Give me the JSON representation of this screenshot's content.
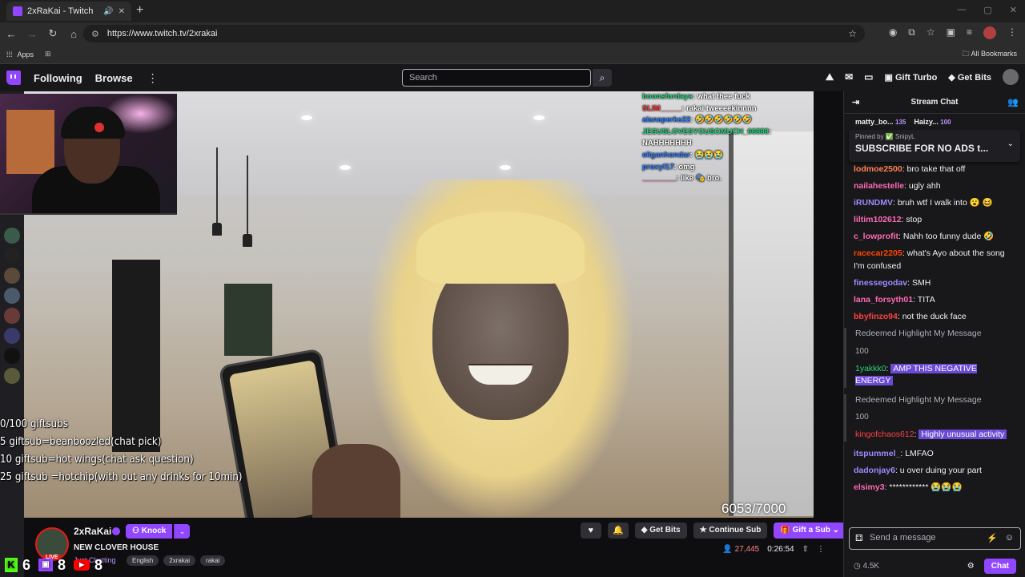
{
  "browser": {
    "tab_title": "2xRaKai - Twitch",
    "url": "https://www.twitch.tv/2xrakai",
    "bookmarks_apps": "Apps",
    "all_bookmarks": "All Bookmarks"
  },
  "nav": {
    "following": "Following",
    "browse": "Browse",
    "search_placeholder": "Search",
    "gift_turbo": "Gift Turbo",
    "get_bits": "Get Bits"
  },
  "overlay_chat": [
    {
      "user": "boonsfordays",
      "msg": "what thee fuck",
      "color": "#27d37a"
    },
    {
      "user": "SLIM_____",
      "msg": "rakai tweeeekinnnn",
      "color": "#ff3b3b"
    },
    {
      "user": "alanaperks22",
      "msg": "🤣🤣🤣🤣🤣🤣",
      "color": "#2d7cff"
    },
    {
      "user": "JESUSLOVESYOUSOMUCH_66888",
      "msg": "NAHHHHHHH",
      "color": "#27d37a"
    },
    {
      "user": "eliganhondar",
      "msg": "😭😭😭",
      "color": "#2d7cff"
    },
    {
      "user": "proxyf17",
      "msg": "omg",
      "color": "#2d7cff"
    },
    {
      "user": "________",
      "msg": "like 🎭 bro.",
      "color": "#ff3b3b"
    }
  ],
  "gift_goals": {
    "line1": "0/100 giftsubs",
    "line2": "5 giftsub=beanboozled(chat pick)",
    "line3": "10 giftsub=hot wings(chat ask question)",
    "line4": "25 giftsub =hotchip(with out any drinks for 10min)"
  },
  "view_progress": "6053/7000",
  "channel": {
    "name": "2xRaKai",
    "knock_label": "Knock",
    "stream_title": "NEW CLOVER HOUSE",
    "category": "Just Chatting",
    "tags": [
      "English",
      "2xrakai",
      "rakai"
    ],
    "live_badge": "LIVE",
    "get_bits": "Get Bits",
    "continue_sub": "Continue Sub",
    "gift_sub": "Gift a Sub",
    "viewers": "27,445",
    "uptime": "0:26:54"
  },
  "bottom_overlay": {
    "kick_count": "6",
    "twitch_count": "8",
    "youtube_count": "8"
  },
  "chat": {
    "header": "Stream Chat",
    "leaderboard": [
      {
        "name": "matty_bo...",
        "pts": "135"
      },
      {
        "name": "Haizy...",
        "pts": "100"
      }
    ],
    "pinned_by": "Pinned by ✅ SnipyL",
    "pinned_text": "SUBSCRIBE FOR NO ADS t...",
    "messages": [
      {
        "user": "lodmoe2500",
        "text": "bro take that off",
        "color": "#ff7f50"
      },
      {
        "user": "nailahestelle",
        "text": "ugly ahh",
        "color": "#ff69b4"
      },
      {
        "user": "iRUNDMV",
        "text": "bruh wtf I walk into 😮 😆",
        "color": "#9b8cff"
      },
      {
        "user": "liltim102612",
        "text": "stop",
        "color": "#ff69b4"
      },
      {
        "user": "c_lowprofit",
        "text": "Nahh too funny dude 🤣",
        "color": "#ff69b4"
      },
      {
        "user": "racecar2205",
        "text": "what's Ayo about the song I'm confused",
        "color": "#ff4500"
      },
      {
        "user": "finessegodav",
        "text": "SMH",
        "color": "#9b8cff"
      },
      {
        "user": "lana_forsyth01",
        "text": "TITA",
        "color": "#ff69b4"
      },
      {
        "user": "bbyfinzo94",
        "text": "not the duck face",
        "color": "#ff4040"
      }
    ],
    "highlights": [
      {
        "redeem": "Redeemed Highlight My Message",
        "cost": "100",
        "user": "1yakkk0",
        "text": "AMP THIS NEGATIVE ENERGY",
        "color": "#27d37a"
      },
      {
        "redeem": "Redeemed Highlight My Message",
        "cost": "100",
        "user": "kingofchaos612",
        "text": "Highly unusual activity",
        "color": "#ff4040"
      }
    ],
    "after": [
      {
        "user": "itspummel_",
        "text": "LMFAO",
        "color": "#9b8cff"
      },
      {
        "user": "dadonjay6",
        "text": "u over duing your part",
        "color": "#9b8cff"
      },
      {
        "user": "elsimy3",
        "text": "************ 😭😭😭",
        "color": "#ff69b4"
      }
    ],
    "input_placeholder": "Send a message",
    "points": "4.5K",
    "chat_button": "Chat"
  }
}
